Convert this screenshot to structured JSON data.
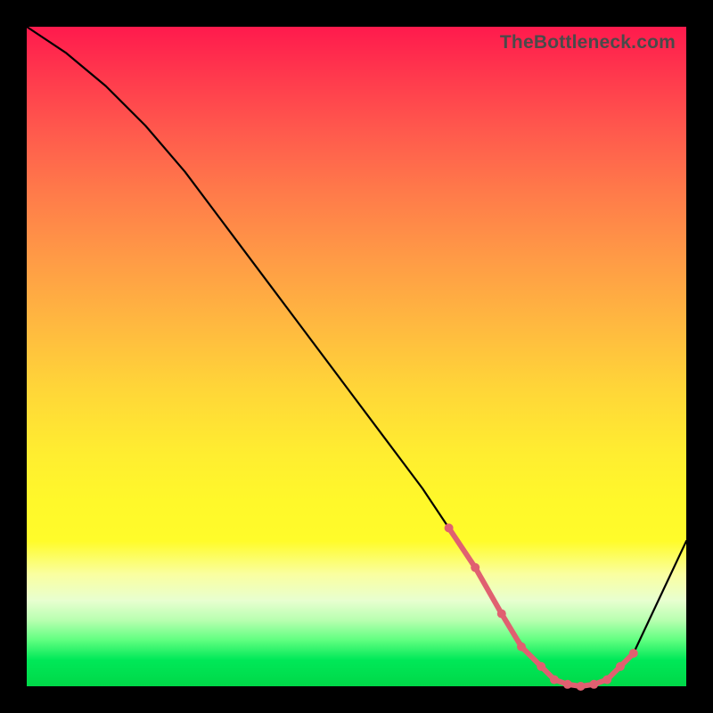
{
  "watermark": "TheBottleneck.com",
  "chart_data": {
    "type": "line",
    "title": "",
    "xlabel": "",
    "ylabel": "",
    "xlim": [
      0,
      100
    ],
    "ylim": [
      0,
      100
    ],
    "series": [
      {
        "name": "bottleneck-curve",
        "x": [
          0,
          6,
          12,
          18,
          24,
          30,
          36,
          42,
          48,
          54,
          60,
          64,
          68,
          72,
          76,
          80,
          84,
          88,
          92,
          100
        ],
        "values": [
          100,
          96,
          91,
          85,
          78,
          70,
          62,
          54,
          46,
          38,
          30,
          24,
          18,
          11,
          5,
          1,
          0,
          1,
          5,
          22
        ]
      }
    ],
    "optimal_range": {
      "x": [
        64,
        68,
        72,
        75,
        78,
        80,
        82,
        84,
        86,
        88,
        90,
        92
      ],
      "values": [
        24,
        18,
        11,
        6,
        3,
        1,
        0.3,
        0,
        0.3,
        1,
        3,
        5
      ]
    },
    "background_gradient": {
      "top": "#ff1a4d",
      "mid": "#ffee30",
      "bottom": "#00d848"
    }
  }
}
